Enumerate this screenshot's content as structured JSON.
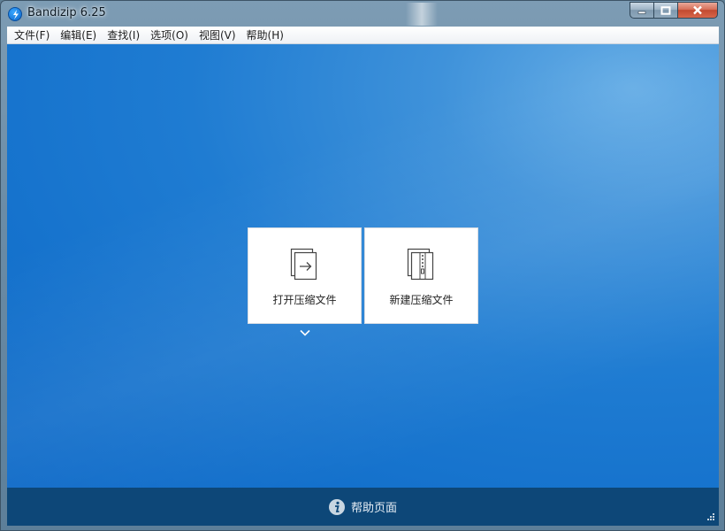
{
  "window": {
    "title": "Bandizip 6.25",
    "controls": {
      "minimize": "▁",
      "maximize": "□",
      "close": "✕"
    }
  },
  "menu": {
    "items": [
      "文件(F)",
      "编辑(E)",
      "查找(I)",
      "选项(O)",
      "视图(V)",
      "帮助(H)"
    ]
  },
  "main": {
    "open_label": "打开压缩文件",
    "new_label": "新建压缩文件"
  },
  "footer": {
    "help_label": "帮助页面"
  },
  "icons": {
    "app": "bandizip-logo-icon",
    "open": "open-archive-icon",
    "new": "new-archive-icon",
    "dropdown": "chevron-down-icon",
    "help": "info-icon",
    "resize": "resize-grip-icon"
  },
  "colors": {
    "background_blue": "#1f7cd2",
    "footer": "#0d4778",
    "card": "#ffffff"
  }
}
